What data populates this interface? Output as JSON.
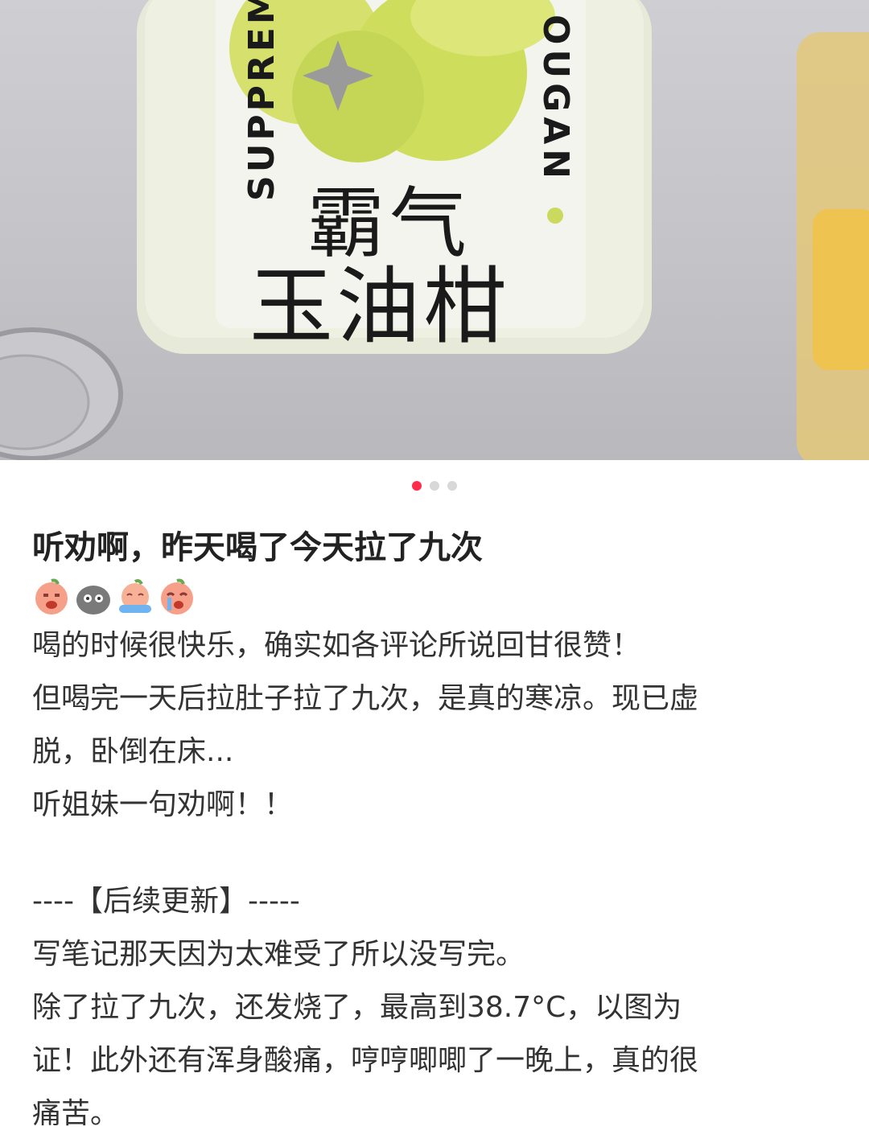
{
  "photo": {
    "label_line1": "霸气",
    "label_line2": "玉油柑",
    "vertical_left": "SUPPREM",
    "vertical_right": "OUGAN"
  },
  "carousel": {
    "count": 3,
    "active_index": 0
  },
  "post": {
    "title": "听劝啊，昨天喝了今天拉了九次",
    "emojis": [
      "crying-face-emoji",
      "gray-blob-emoji",
      "tears-face-emoji",
      "crying-face-emoji"
    ],
    "lines": [
      "喝的时候很快乐，确实如各评论所说回甘很赞！",
      "但喝完一天后拉肚子拉了九次，是真的寒凉。现已虚",
      "脱，卧倒在床...",
      "听姐妹一句劝啊！！"
    ],
    "update_lines": [
      "----【后续更新】-----",
      "写笔记那天因为太难受了所以没写完。",
      "除了拉了九次，还发烧了，最高到38.7°C，以图为",
      "证！此外还有浑身酸痛，哼哼唧唧了一晚上，真的很",
      "痛苦。"
    ]
  },
  "colors": {
    "accent": "#ff2d4b",
    "text": "#333333",
    "inactive_dot": "#d8d8d8"
  }
}
